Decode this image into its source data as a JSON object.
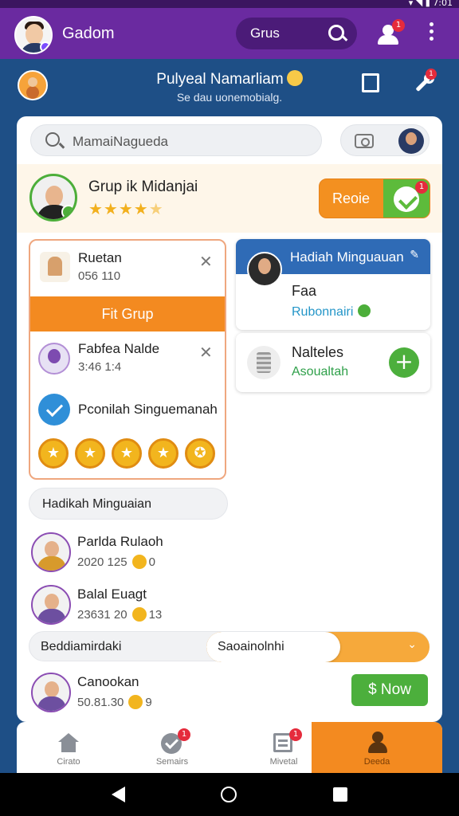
{
  "header": {
    "app_title": "Gadom",
    "search_label": "Grus",
    "notification_count": "1"
  },
  "subheader": {
    "title": "Pulyeal Namarliam",
    "subtitle": "Se dau uonemobialg.",
    "badge_count": "1"
  },
  "search": {
    "value": "MamaiNagueda"
  },
  "group": {
    "title": "Grup ik Midanjai",
    "rating": 4,
    "rating_max": 5,
    "stars_filled": "★★★★",
    "stars_empty": "★",
    "button_label": "Reoie",
    "button_badge": "1"
  },
  "left_panel": {
    "item1_name": "Ruetan",
    "item1_value": "056 110",
    "fit_button": "Fit Grup",
    "item2_name": "Fabfea Nalde",
    "item2_value": "3:46 1:4",
    "item3_label": "Pconilah Singuemanah",
    "coins": [
      "★",
      "★",
      "★",
      "★",
      "✪"
    ]
  },
  "right_panel": {
    "header": "Hadiah Minguauan",
    "name": "Faa",
    "link": "Rubonnairi",
    "card2_title": "Nalteles",
    "card2_subtitle": "Asoualtah",
    "plus_label": "+"
  },
  "list": {
    "section_title": "Hadikah Minguaian",
    "items": [
      {
        "name": "Parlda Rulaoh",
        "meta": "2020 125",
        "coins": "0"
      },
      {
        "name": "Balal Euagt",
        "meta": "23631 20",
        "coins": "13"
      },
      {
        "name": "Canookan",
        "meta": "50.81.30",
        "coins": "9"
      }
    ]
  },
  "filter": {
    "label": "Beddiamirdaki",
    "select_value": "Saoainolnhi",
    "chevron": "⌄"
  },
  "now_button": "$ Now",
  "bottom_nav": [
    {
      "label": "Cirato"
    },
    {
      "label": "Semairs",
      "badge": "1"
    },
    {
      "label": "Mivetal",
      "badge": "1"
    },
    {
      "label": "Deeda"
    }
  ],
  "colors": {
    "appbar": "#6a2aa0",
    "background": "#1e4f86",
    "accent_orange": "#f38a20",
    "accent_green": "#4caf3c",
    "accent_blue": "#2f6bb6"
  }
}
